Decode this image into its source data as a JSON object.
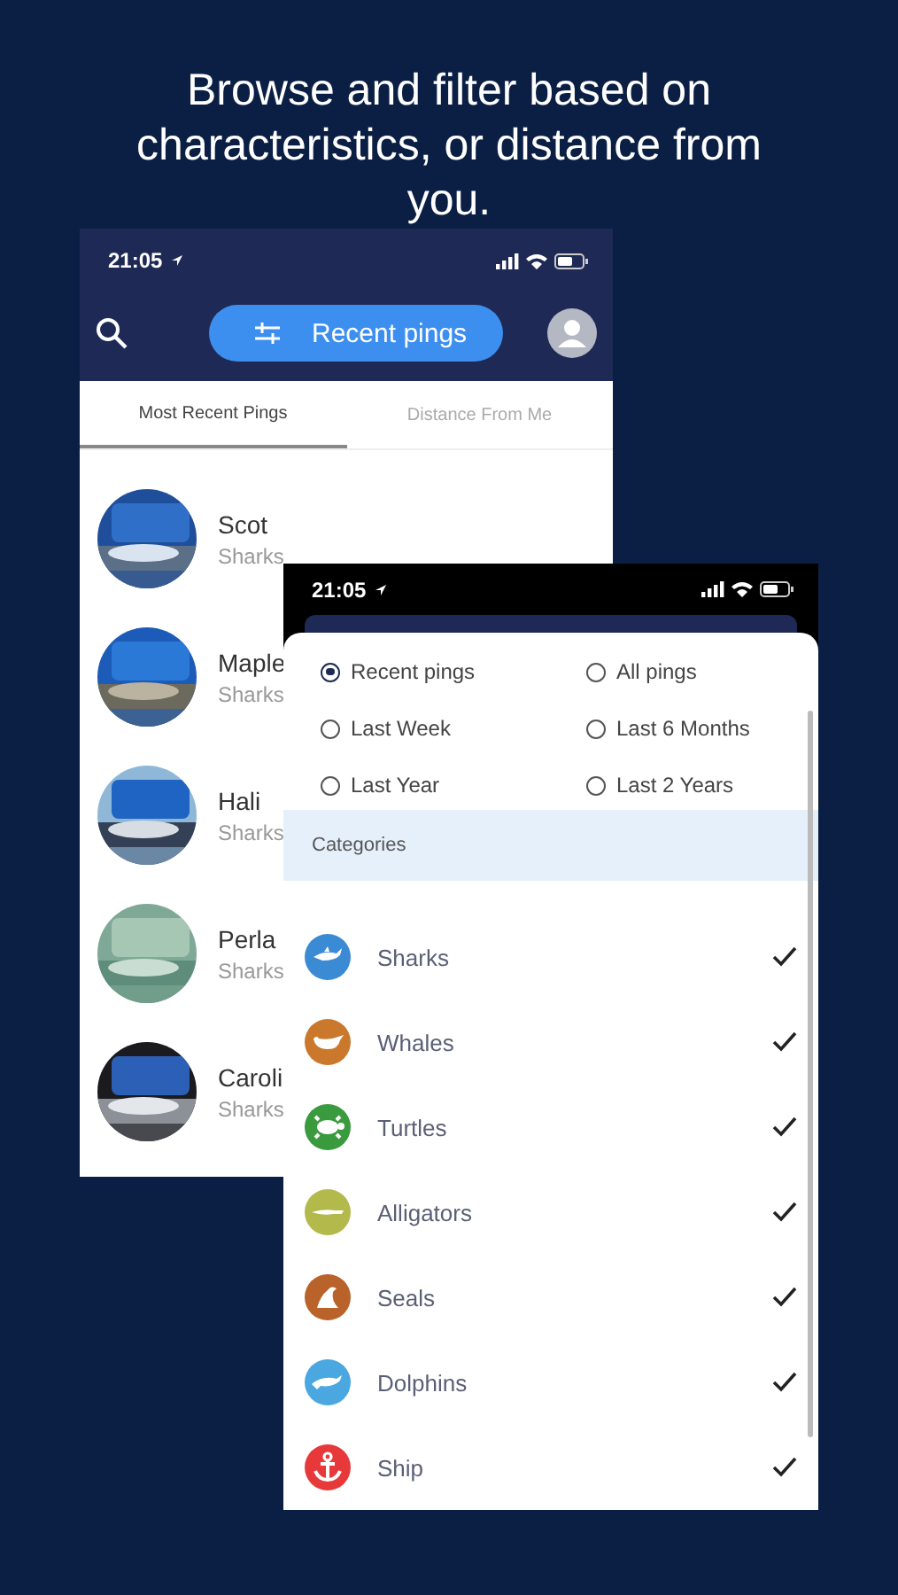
{
  "headline": "Browse and filter based on characteristics, or distance from you.",
  "back_screen": {
    "status_time": "21:05",
    "filter_button": "Recent pings",
    "tabs": [
      {
        "label": "Most Recent Pings",
        "selected": true
      },
      {
        "label": "Distance From Me",
        "selected": false
      }
    ],
    "pings": [
      {
        "name": "Scot",
        "category": "Sharks",
        "kind": "picture"
      },
      {
        "name": "Maple",
        "category": "Sharks",
        "kind": "picture"
      },
      {
        "name": "Hali",
        "category": "Sharks",
        "kind": "picture"
      },
      {
        "name": "Perla",
        "category": "Sharks",
        "kind": "picture"
      },
      {
        "name": "Caroli",
        "category": "Sharks",
        "kind": "picture"
      }
    ]
  },
  "front_screen": {
    "status_time": "21:05",
    "periods": [
      {
        "label": "Recent pings",
        "selected": true
      },
      {
        "label": "All pings",
        "selected": false
      },
      {
        "label": "Last Week",
        "selected": false
      },
      {
        "label": "Last 6 Months",
        "selected": false
      },
      {
        "label": "Last Year",
        "selected": false
      },
      {
        "label": "Last 2 Years",
        "selected": false
      }
    ],
    "categories_header": "Categories",
    "categories": [
      {
        "name": "Sharks",
        "kind": "shark",
        "color": "#3b8ad4",
        "checked": true
      },
      {
        "name": "Whales",
        "kind": "whale",
        "color": "#c9782c",
        "checked": true
      },
      {
        "name": "Turtles",
        "kind": "turtle",
        "color": "#3a9a3e",
        "checked": true
      },
      {
        "name": "Alligators",
        "kind": "alligator",
        "color": "#b3b94a",
        "checked": true
      },
      {
        "name": "Seals",
        "kind": "seal",
        "color": "#b9622a",
        "checked": true
      },
      {
        "name": "Dolphins",
        "kind": "dolphin",
        "color": "#4aa7e0",
        "checked": true
      },
      {
        "name": "Ship",
        "kind": "ship",
        "color": "#e8393a",
        "checked": true
      }
    ]
  }
}
